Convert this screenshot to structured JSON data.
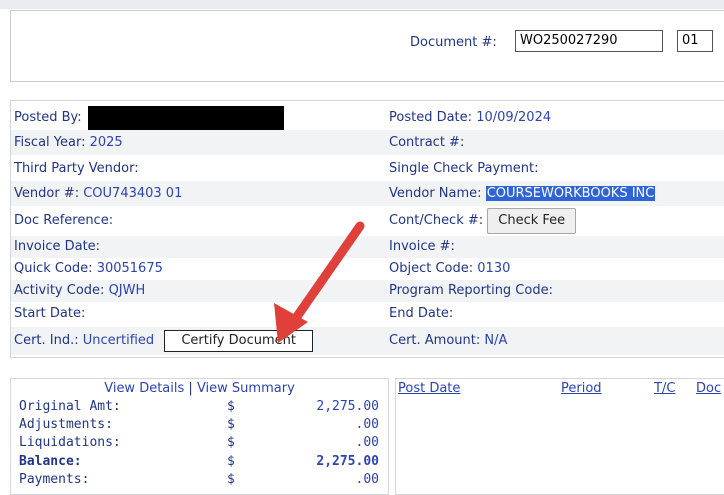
{
  "header": {
    "document_label": "Document #:",
    "document_number": "WO250027290",
    "document_suffix": "01"
  },
  "details": {
    "posted_by_label": "Posted By:",
    "posted_date_label": "Posted Date:",
    "posted_date": "10/09/2024",
    "fiscal_year_label": "Fiscal Year:",
    "fiscal_year": "2025",
    "contract_label": "Contract #:",
    "third_party_label": "Third Party Vendor:",
    "single_check_label": "Single Check Payment:",
    "vendor_no_label": "Vendor #:",
    "vendor_no": "COU743403 01",
    "vendor_name_label": "Vendor Name:",
    "vendor_name": "COURSEWORKBOOKS INC",
    "doc_reference_label": "Doc Reference:",
    "cont_check_label": "Cont/Check #:",
    "check_fee_button": "Check Fee",
    "invoice_date_label": "Invoice Date:",
    "invoice_no_label": "Invoice #:",
    "quick_code_label": "Quick Code:",
    "quick_code": "30051675",
    "object_code_label": "Object Code:",
    "object_code": "0130",
    "activity_code_label": "Activity Code:",
    "activity_code": "QJWH",
    "program_code_label": "Program Reporting Code:",
    "start_date_label": "Start Date:",
    "end_date_label": "End Date:",
    "cert_ind_label": "Cert. Ind.:",
    "cert_ind": "Uncertified",
    "certify_button": "Certify Document",
    "cert_amount_label": "Cert. Amount:",
    "cert_amount": "N/A"
  },
  "summary": {
    "view_details": "View Details",
    "separator": "|",
    "view_summary": "View Summary",
    "rows": [
      {
        "label": "Original Amt:",
        "currency": "$",
        "value": "2,275.00"
      },
      {
        "label": "Adjustments:",
        "currency": "$",
        "value": ".00"
      },
      {
        "label": "Liquidations:",
        "currency": "$",
        "value": ".00"
      },
      {
        "label": "Balance:",
        "currency": "$",
        "value": "2,275.00"
      },
      {
        "label": "Payments:",
        "currency": "$",
        "value": ".00"
      }
    ]
  },
  "history": {
    "columns": [
      "Post Date",
      "Period",
      "T/C",
      "Doc"
    ]
  },
  "colors": {
    "label": "#20358a",
    "value": "#2c43b5",
    "highlight": "#2f64d8",
    "arrow": "#e0403a"
  },
  "annotation": {
    "icon": "red-arrow-icon"
  }
}
